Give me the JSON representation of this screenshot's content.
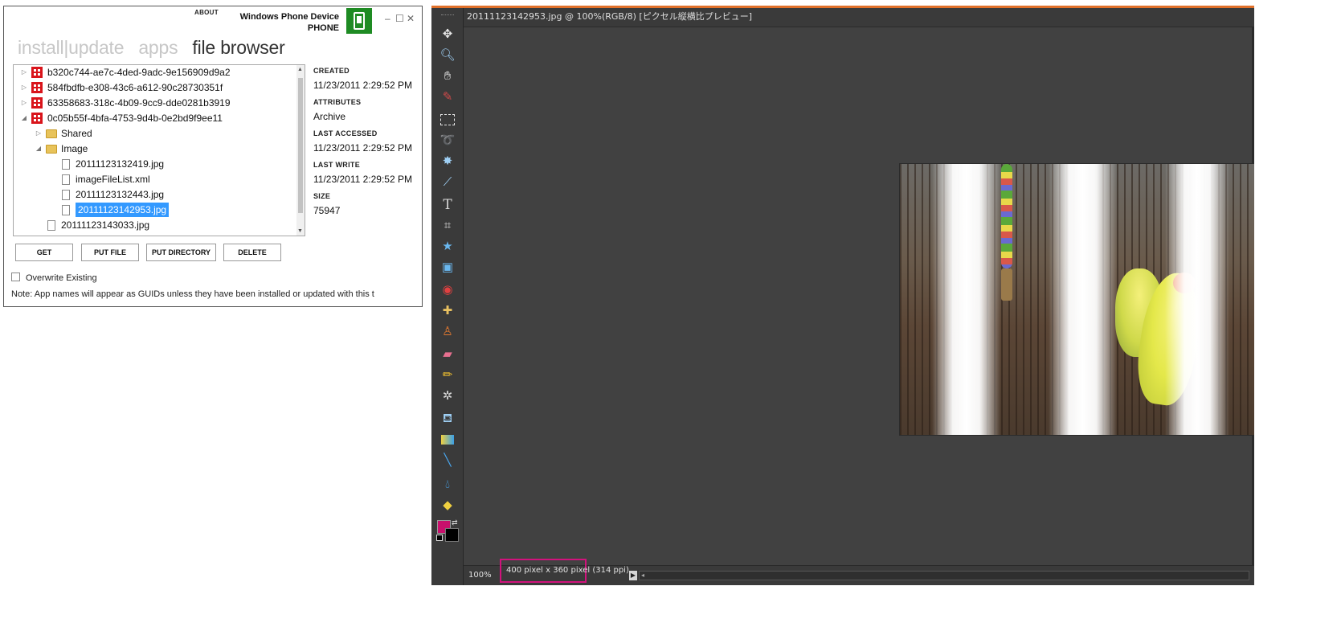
{
  "wpd": {
    "about": "ABOUT",
    "title_line1": "Windows Phone Device",
    "title_line2": "PHONE",
    "window_controls": [
      "–",
      "☐",
      "✕"
    ],
    "nav": [
      "install|update",
      "apps",
      "file browser"
    ],
    "tree": [
      {
        "label": "b320c744-ae7c-4ded-9adc-9e156909d9a2",
        "icon": "app-icon",
        "expander": "▷"
      },
      {
        "label": "584fbdfb-e308-43c6-a612-90c28730351f",
        "icon": "app-icon",
        "expander": "▷"
      },
      {
        "label": "63358683-318c-4b09-9cc9-dde0281b3919",
        "icon": "app-icon",
        "expander": "▷"
      },
      {
        "label": "0c05b55f-4bfa-4753-9d4b-0e2bd9f9ee11",
        "icon": "app-icon",
        "expander": "◢"
      },
      {
        "label": "Shared",
        "icon": "folder-icon",
        "expander": "▷"
      },
      {
        "label": "Image",
        "icon": "folder-icon",
        "expander": "◢"
      },
      {
        "label": "20111123132419.jpg",
        "icon": "file-icon",
        "expander": ""
      },
      {
        "label": "imageFileList.xml",
        "icon": "file-icon",
        "expander": ""
      },
      {
        "label": "20111123132443.jpg",
        "icon": "file-icon",
        "expander": ""
      },
      {
        "label": "20111123142953.jpg",
        "icon": "file-icon",
        "expander": "",
        "selected": true
      },
      {
        "label": "20111123143033.jpg",
        "icon": "file-icon",
        "expander": ""
      }
    ],
    "props": {
      "created_label": "CREATED",
      "created": "11/23/2011 2:29:52 PM",
      "attributes_label": "ATTRIBUTES",
      "attributes": "Archive",
      "last_accessed_label": "LAST ACCESSED",
      "last_accessed": "11/23/2011 2:29:52 PM",
      "last_write_label": "LAST WRITE",
      "last_write": "11/23/2011 2:29:52 PM",
      "size_label": "SIZE",
      "size": "75947"
    },
    "buttons": {
      "get": "GET",
      "put_file": "PUT FILE",
      "put_directory": "PUT DIRECTORY",
      "delete": "DELETE"
    },
    "overwrite_label": "Overwrite Existing",
    "note": "Note: App names will appear as GUIDs unless they have been installed or updated with this t"
  },
  "editor": {
    "doc_title": "20111123142953.jpg @ 100%(RGB/8) [ピクセル縦横比プレビュー]",
    "zoom": "100%",
    "doc_info": "400 pixel x 360 pixel (314 ppi)",
    "tools": [
      "move-tool-icon",
      "zoom-tool-icon",
      "hand-tool-icon",
      "eyedropper-tool-icon",
      "marquee-tool-icon",
      "lasso-tool-icon",
      "magic-wand-tool-icon",
      "selection-brush-tool-icon",
      "type-tool-icon",
      "crop-tool-icon",
      "shape-tool-icon",
      "recompose-tool-icon",
      "red-eye-tool-icon",
      "healing-brush-tool-icon",
      "clone-stamp-tool-icon",
      "eraser-tool-icon",
      "pencil-tool-icon",
      "brush-tool-icon",
      "paint-bucket-tool-icon",
      "gradient-tool-icon",
      "line-tool-icon",
      "blur-tool-icon",
      "sponge-tool-icon"
    ],
    "fg_color": "#c8106c",
    "bg_color": "#000000",
    "accent": "#e0702a",
    "highlight": "#d1127c"
  }
}
